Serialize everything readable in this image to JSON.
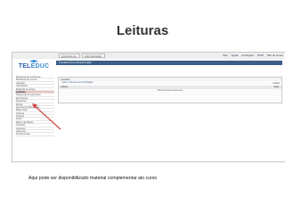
{
  "slide": {
    "title": "Leituras",
    "caption": "Aqui pode ser disponibilizado material complementar aio curso"
  },
  "app": {
    "logo_text_a": "TEL",
    "logo_text_b": "EDUC",
    "top_tabs": [
      "Ambiente do Curso",
      "Administração"
    ],
    "top_links": [
      "Sair",
      "Ajuda",
      "Configurar",
      "Perfil",
      "Sair do Curso"
    ],
    "course_title": "Fundamentos da Educação",
    "sidebar_items": [
      "Estrutura do Ambiente",
      "Dinâmica do Curso",
      "Agenda",
      "Atividades",
      "Material de Apoio",
      "Leituras",
      "Perguntas Frequentes",
      "Exercícios",
      "Enquetes",
      "Mural",
      "Fóruns de Discussão",
      "Bate-Papo",
      "Correio",
      "Grupos",
      "Perfil",
      "Diário de Bordo",
      "Portfólio",
      "Acessos",
      "Intermap",
      "Ferramentas"
    ],
    "active_item_index": 5,
    "panel": {
      "title": "Leituras",
      "subtitle": "Ação: Leituras Compartilhadas",
      "column_left": "Leitura",
      "column_right": "Data",
      "empty_text": "Não há leituras disponíveis",
      "side_link": "Lixeira"
    }
  },
  "colors": {
    "accent": "#3b5f86",
    "active_item": "#e8c4c4",
    "arrow": "#d24444"
  }
}
